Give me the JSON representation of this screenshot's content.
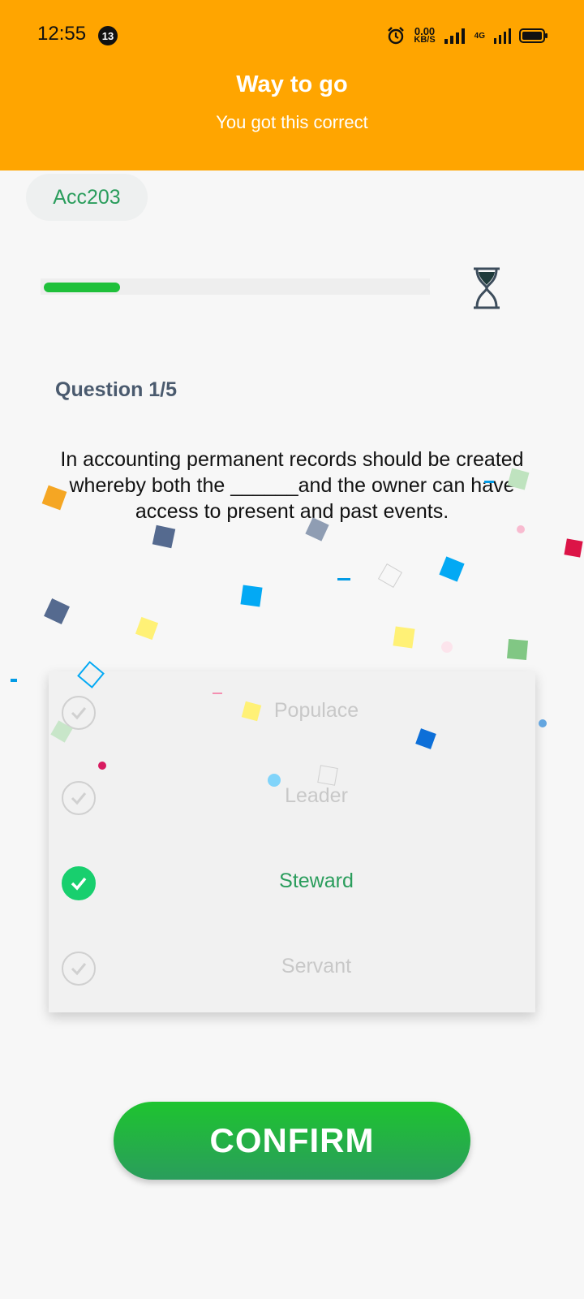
{
  "status_bar": {
    "time": "12:55",
    "notification_count": "13",
    "net_speed_value": "0.00",
    "net_speed_unit": "KB/S",
    "network_type": "4G"
  },
  "banner": {
    "title": "Way to go",
    "subtitle": "You got this correct"
  },
  "course": {
    "code": "Acc203"
  },
  "progress": {
    "fraction": 0.2
  },
  "question": {
    "label": "Question 1/5",
    "text": "In accounting permanent records should be created whereby both the ______and the owner can have access to present and past events."
  },
  "options": [
    {
      "label": "Populace",
      "selected": false
    },
    {
      "label": "Leader",
      "selected": false
    },
    {
      "label": "Steward",
      "selected": true
    },
    {
      "label": "Servant",
      "selected": false
    }
  ],
  "confirm_button": {
    "label": "CONFIRM"
  },
  "colors": {
    "accent": "#ffa500",
    "success": "#2a9d5c",
    "progress": "#1fc03a",
    "selected_check": "#18cf6e"
  }
}
